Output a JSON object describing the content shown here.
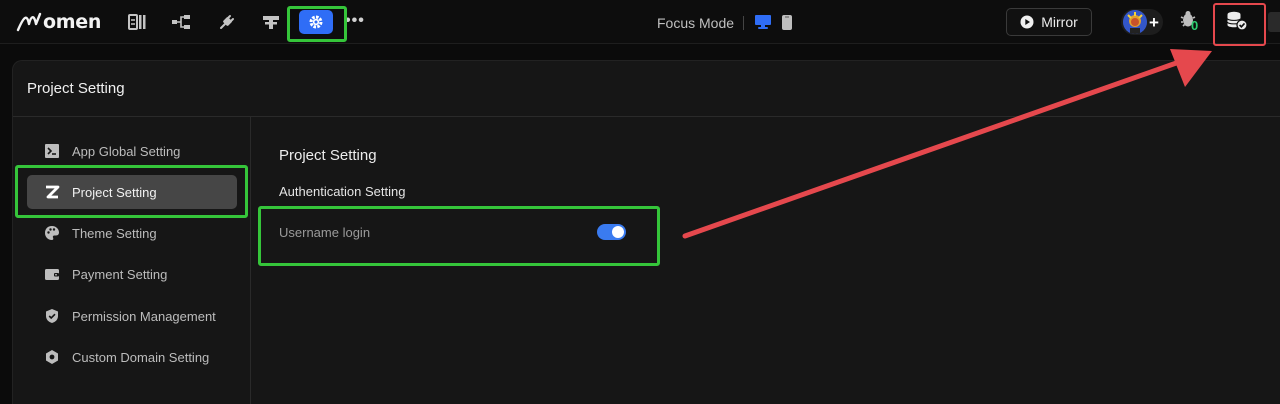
{
  "topbar": {
    "logo_text": "omen",
    "focus_mode": "Focus Mode",
    "mirror_label": "Mirror",
    "bug_count": "0",
    "icons": [
      "layout-icon",
      "tree-icon",
      "plug-icon",
      "component-icon",
      "settings-icon",
      "more-icon",
      "monitor-icon",
      "phone-icon",
      "play-icon",
      "avatar",
      "plus-icon",
      "bug-icon",
      "database-check-icon"
    ]
  },
  "panel": {
    "title": "Project Setting"
  },
  "sidebar": {
    "items": [
      {
        "label": "App Global Setting",
        "icon": "terminal-icon"
      },
      {
        "label": "Project Setting",
        "icon": "z-logo-icon"
      },
      {
        "label": "Theme Setting",
        "icon": "palette-icon"
      },
      {
        "label": "Payment Setting",
        "icon": "wallet-icon"
      },
      {
        "label": "Permission Management",
        "icon": "shield-icon"
      },
      {
        "label": "Custom Domain Setting",
        "icon": "gear-domain-icon"
      }
    ]
  },
  "content": {
    "title": "Project Setting",
    "section_title": "Authentication Setting",
    "option_label": "Username login",
    "option_enabled": true
  },
  "colors": {
    "accent": "#2f6df6",
    "highlight_green": "#35c53a",
    "highlight_red": "#e5484d",
    "bug_count": "#2ecc71"
  }
}
